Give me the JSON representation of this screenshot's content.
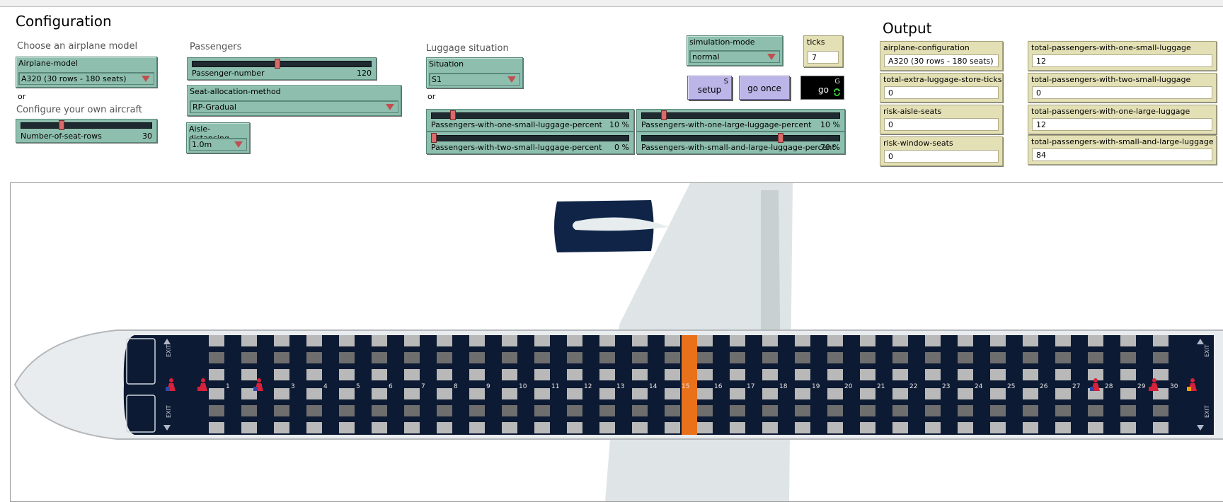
{
  "config": {
    "title": "Configuration",
    "choose_model_label": "Choose an airplane model",
    "airplane_model": {
      "title": "Airplane-model",
      "value": "A320 (30 rows - 180 seats)"
    },
    "or_1": "or",
    "configure_label": "Configure your own aircraft",
    "seat_rows": {
      "name": "Number-of-seat-rows",
      "value": "30",
      "fraction": 0.3
    },
    "passengers_label": "Passengers",
    "passenger_number": {
      "name": "Passenger-number",
      "value": "120",
      "fraction": 0.47
    },
    "seat_allocation": {
      "title": "Seat-allocation-method",
      "value": "RP-Gradual"
    },
    "aisle_distancing": {
      "title": "Aisle-distancing",
      "value": "1.0m"
    },
    "luggage_label": "Luggage situation",
    "situation": {
      "title": "Situation",
      "value": "S1"
    },
    "or_2": "or",
    "small_one": {
      "name": "Passengers-with-one-small-luggage-percent",
      "value": "10 %",
      "fraction": 0.1
    },
    "small_two": {
      "name": "Passengers-with-two-small-luggage-percent",
      "value": "0 %",
      "fraction": 0.0
    },
    "large_one": {
      "name": "Passengers-with-one-large-luggage-percent",
      "value": "10 %",
      "fraction": 0.1
    },
    "small_large": {
      "name": "Passengers-with-small-and-large-luggage-percent",
      "value": "70 %",
      "fraction": 0.7
    },
    "simulation_mode": {
      "title": "simulation-mode",
      "value": "normal"
    },
    "ticks": {
      "title": "ticks",
      "value": "7"
    },
    "buttons": {
      "setup": "setup",
      "setup_key": "S",
      "go_once": "go once",
      "go": "go",
      "go_key": "G"
    }
  },
  "output": {
    "title": "Output",
    "monitors": [
      {
        "title": "airplane-configuration",
        "value": "A320 (30 rows - 180 seats)"
      },
      {
        "title": "total-extra-luggage-store-ticks",
        "value": "0"
      },
      {
        "title": "risk-aisle-seats",
        "value": "0"
      },
      {
        "title": "risk-window-seats",
        "value": "0"
      },
      {
        "title": "total-passengers-with-one-small-luggage",
        "value": "12"
      },
      {
        "title": "total-passengers-with-two-small-luggage",
        "value": "0"
      },
      {
        "title": "total-passengers-with-one-large-luggage",
        "value": "12"
      },
      {
        "title": "total-passengers-with-small-and-large-luggage",
        "value": "84"
      }
    ]
  },
  "world": {
    "row_numbers": [
      "1",
      "2",
      "3",
      "4",
      "5",
      "6",
      "7",
      "8",
      "9",
      "10",
      "11",
      "12",
      "13",
      "14",
      "15",
      "16",
      "17",
      "18",
      "19",
      "20",
      "21",
      "22",
      "23",
      "24",
      "25",
      "26",
      "27",
      "28",
      "29",
      "30"
    ],
    "exit_label": "EXIT",
    "highlight_row": 15,
    "colors": {
      "cabin": "#0d1a33",
      "seat_light": "#b9b9b9",
      "seat_dark": "#6e6e6e",
      "highlight": "#e8711a",
      "engine": "#0f2447",
      "wing": "#dfe5e6"
    },
    "icons": [
      "passenger-icon",
      "toilet-icon",
      "galley-icon",
      "exit-arrow-icon"
    ]
  }
}
